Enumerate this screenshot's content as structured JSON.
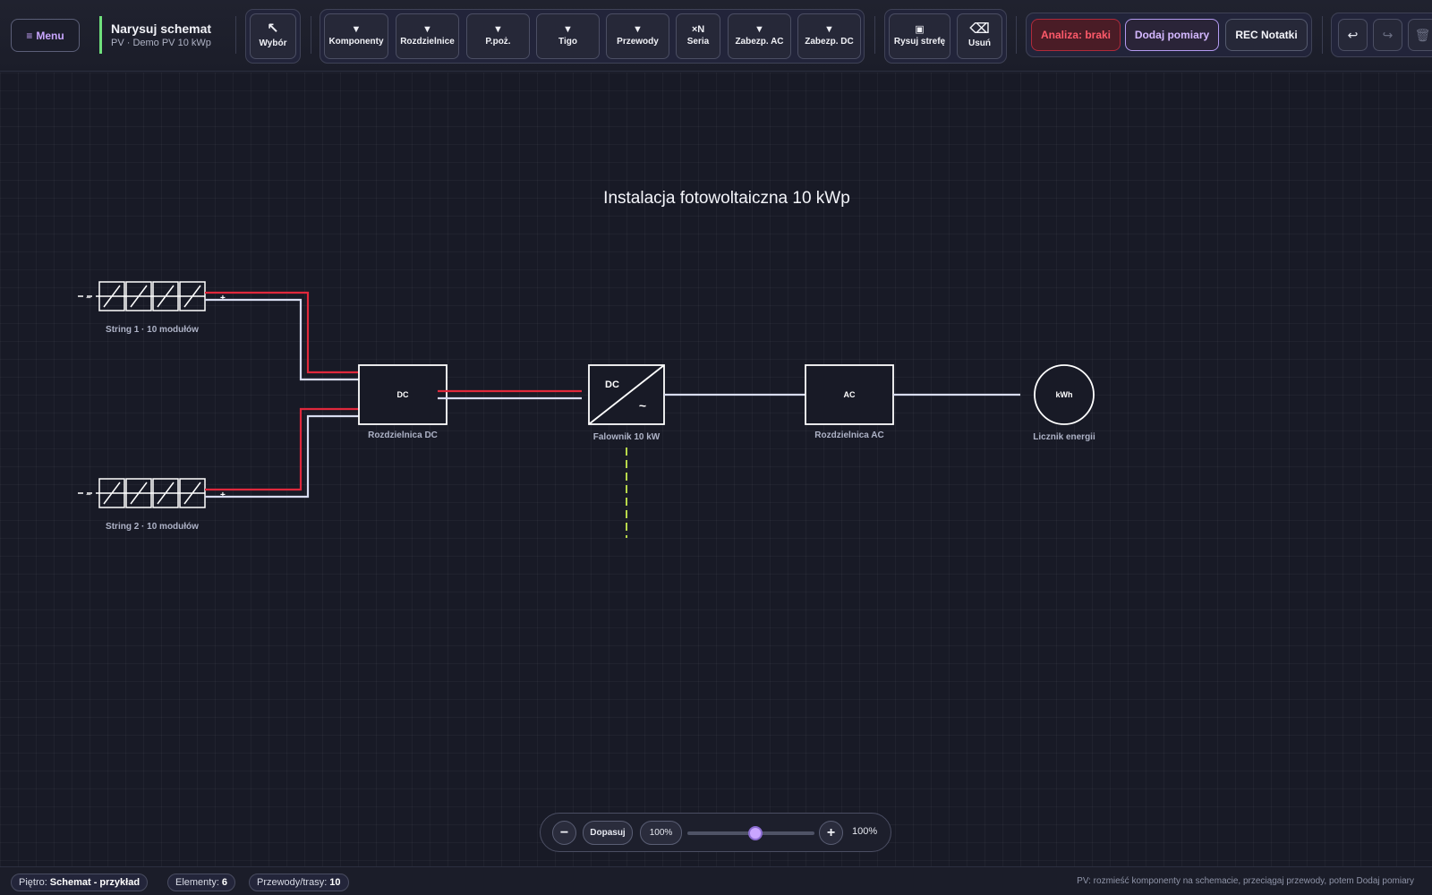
{
  "toolbar": {
    "menu_label": "Menu",
    "title": "Narysuj schemat",
    "subtitle": "PV · Demo PV 10 kWp",
    "select_tool": {
      "label": "Wybór",
      "icon": "select-arrow-icon"
    },
    "tools": [
      {
        "label": "Komponenty",
        "icon": "dropdown-triangle-icon"
      },
      {
        "label": "Rozdzielnice",
        "icon": "dropdown-triangle-icon"
      },
      {
        "label": "P.poż.",
        "icon": "dropdown-triangle-icon"
      },
      {
        "label": "Tigo",
        "icon": "dropdown-triangle-icon"
      },
      {
        "label": "Przewody",
        "icon": "dropdown-triangle-icon"
      },
      {
        "label": "Seria",
        "icon_text": "×N"
      },
      {
        "label": "Zabezp. AC",
        "icon": "dropdown-triangle-icon"
      },
      {
        "label": "Zabezp. DC",
        "icon": "dropdown-triangle-icon"
      }
    ],
    "draw_zone_label": "Rysuj strefę",
    "delete_label": "Usuń",
    "analysis_label": "Analiza: braki",
    "add_measurements_label": "Dodaj pomiary",
    "rec_notes_label": "REC Notatki",
    "colors": {
      "accent": "#c9a6ff",
      "title_bar": "#6fe07c",
      "danger": "#ff5a6a"
    }
  },
  "schematic": {
    "title": "Instalacja fotowoltaiczna 10 kWp",
    "components": {
      "string1_label": "String 1 · 10 modułów",
      "string2_label": "String 2 · 10 modułów",
      "dc_box_symbol": "DC",
      "dc_box_label": "Rozdzielnica DC",
      "inverter_dc": "DC",
      "inverter_ac": "~",
      "inverter_label": "Falownik 10 kW",
      "ac_box_symbol": "AC",
      "ac_box_label": "Rozdzielnica AC",
      "meter_symbol": "kWh",
      "meter_label": "Licznik energii",
      "plus_sign": "+",
      "minus_sign": "−"
    },
    "wire_colors": {
      "positive": "#e0283c",
      "negative": "#d8dcf0",
      "ground": "#b8d84a"
    }
  },
  "zoom": {
    "fit_label": "Dopasuj",
    "zoom_chip": "100%",
    "zoom_value": "100%",
    "slider_level": 0.5
  },
  "status": {
    "floor_label": "Piętro:",
    "floor_value": "Schemat - przykład",
    "elements_label": "Elementy:",
    "elements_value": "6",
    "wires_label": "Przewody/trasy:",
    "wires_value": "10",
    "hint": "PV: rozmieść komponenty na schemacie, przeciągaj przewody, potem Dodaj pomiary"
  }
}
